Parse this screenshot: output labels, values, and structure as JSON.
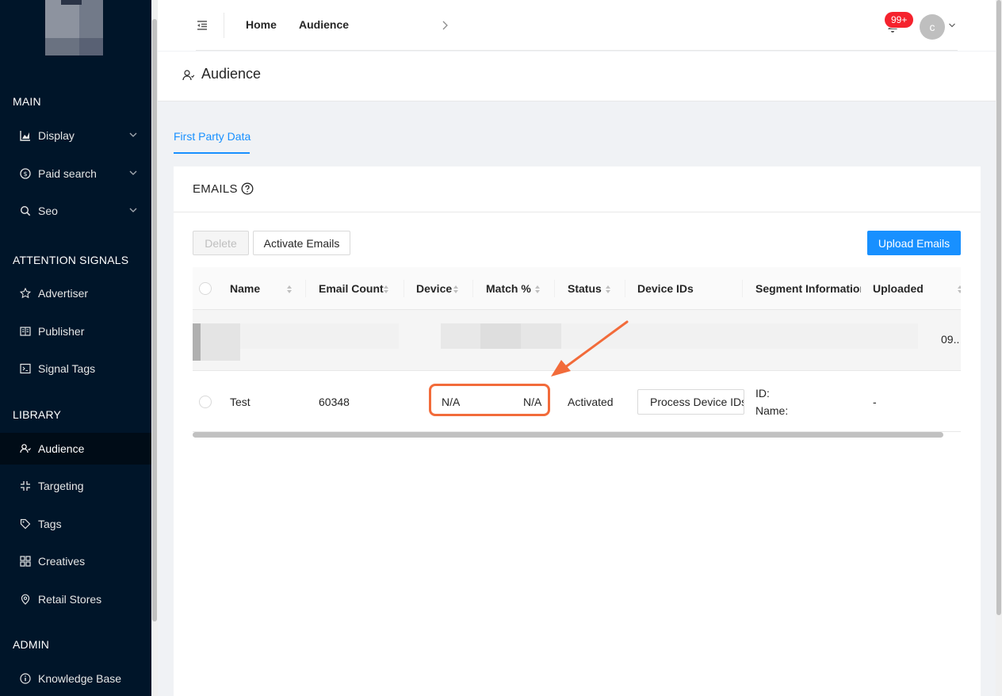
{
  "sidebar": {
    "sections": {
      "main": "MAIN",
      "attention": "ATTENTION SIGNALS",
      "library": "LIBRARY",
      "admin": "ADMIN"
    },
    "items": {
      "display": "Display",
      "paid_search": "Paid search",
      "seo": "Seo",
      "advertiser": "Advertiser",
      "publisher": "Publisher",
      "signal_tags": "Signal Tags",
      "audience": "Audience",
      "targeting": "Targeting",
      "tags": "Tags",
      "creatives": "Creatives",
      "retail_stores": "Retail Stores",
      "knowledge_base": "Knowledge Base"
    },
    "active": "audience"
  },
  "header": {
    "breadcrumb_home": "Home",
    "breadcrumb_current": "Audience",
    "notification_badge": "99+",
    "avatar_initial": "c"
  },
  "page": {
    "title": "Audience",
    "tab_first_party": "First Party Data"
  },
  "card": {
    "title": "EMAILS",
    "buttons": {
      "delete": "Delete",
      "activate": "Activate Emails",
      "upload": "Upload Emails"
    }
  },
  "table": {
    "columns": {
      "name": "Name",
      "email_count": "Email Count",
      "device": "Device",
      "match": "Match %",
      "status": "Status",
      "device_ids": "Device IDs",
      "segment": "Segment Information",
      "uploaded": "Uploaded"
    },
    "blurred_row_tail": "09..",
    "row": {
      "name": "Test",
      "email_count": "60348",
      "device": "N/A",
      "match": "N/A",
      "status": "Activated",
      "device_ids_button": "Process Device IDs",
      "segment_id_label": "ID:",
      "segment_name_label": "Name:",
      "uploaded": "-"
    }
  },
  "colors": {
    "sidebar_bg": "#001529",
    "primary": "#1890ff",
    "badge": "#f5222d",
    "annotation": "#f26b3a"
  }
}
